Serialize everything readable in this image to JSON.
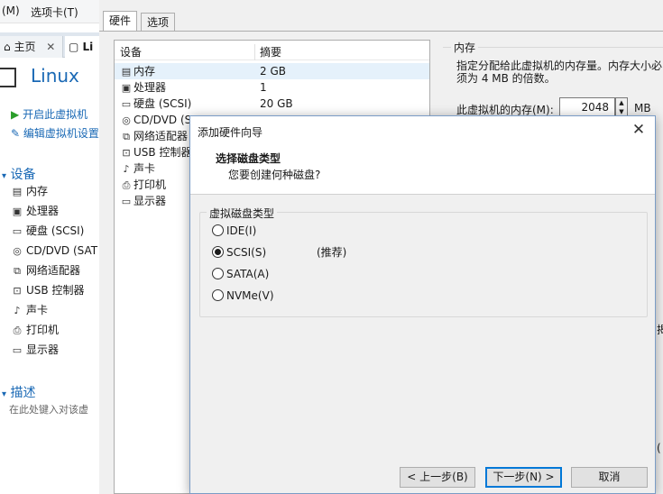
{
  "menubar": {
    "items": [
      "(M)",
      "选项卡(T)",
      "⊞"
    ]
  },
  "left": {
    "tabs": [
      "主页",
      "Li"
    ],
    "vm_title": "Linux",
    "actions": [
      "开启此虚拟机",
      "编辑虚拟机设置"
    ],
    "devices_section": "设备",
    "devices": [
      {
        "icon": "memory-icon",
        "label": "内存"
      },
      {
        "icon": "cpu-icon",
        "label": "处理器"
      },
      {
        "icon": "disk-icon",
        "label": "硬盘 (SCSI)"
      },
      {
        "icon": "cdrom-icon",
        "label": "CD/DVD (SAT"
      },
      {
        "icon": "network-icon",
        "label": "网络适配器"
      },
      {
        "icon": "usb-icon",
        "label": "USB 控制器"
      },
      {
        "icon": "sound-icon",
        "label": "声卡"
      },
      {
        "icon": "printer-icon",
        "label": "打印机"
      },
      {
        "icon": "display-icon",
        "label": "显示器"
      }
    ],
    "description_section": "描述",
    "description_placeholder": "在此处键入对该虚"
  },
  "settings": {
    "tabs": [
      "硬件",
      "选项"
    ],
    "table": {
      "headers": [
        "设备",
        "摘要"
      ],
      "rows": [
        {
          "name": "内存",
          "value": "2 GB"
        },
        {
          "name": "处理器",
          "value": "1"
        },
        {
          "name": "硬盘 (SCSI)",
          "value": "20 GB"
        },
        {
          "name": "CD/DVD (S",
          "value": ""
        },
        {
          "name": "网络适配器",
          "value": ""
        },
        {
          "name": "USB 控制器",
          "value": ""
        },
        {
          "name": "声卡",
          "value": ""
        },
        {
          "name": "打印机",
          "value": ""
        },
        {
          "name": "显示器",
          "value": ""
        }
      ]
    },
    "memory": {
      "group_label": "内存",
      "description": "指定分配给此虚拟机的内存量。内存大小必须为 4 MB 的倍数。",
      "field_label": "此虚拟机的内存(M):",
      "value": "2048",
      "unit": "MB",
      "right_fragment_1": "揭",
      "right_fragment_2": "("
    }
  },
  "dialog": {
    "title": "添加硬件向导",
    "heading": "选择磁盘类型",
    "subheading": "您要创建何种磁盘?",
    "group_label": "虚拟磁盘类型",
    "options": [
      {
        "label": "IDE(I)",
        "selected": false
      },
      {
        "label": "SCSI(S)",
        "selected": true,
        "note": "(推荐)"
      },
      {
        "label": "SATA(A)",
        "selected": false
      },
      {
        "label": "NVMe(V)",
        "selected": false
      }
    ],
    "buttons": {
      "back": "< 上一步(B)",
      "next": "下一步(N) >",
      "cancel": "取消"
    }
  },
  "colors": {
    "accent": "#1a69b5",
    "selection": "#e5f1fb",
    "primary_border": "#0078d7"
  }
}
